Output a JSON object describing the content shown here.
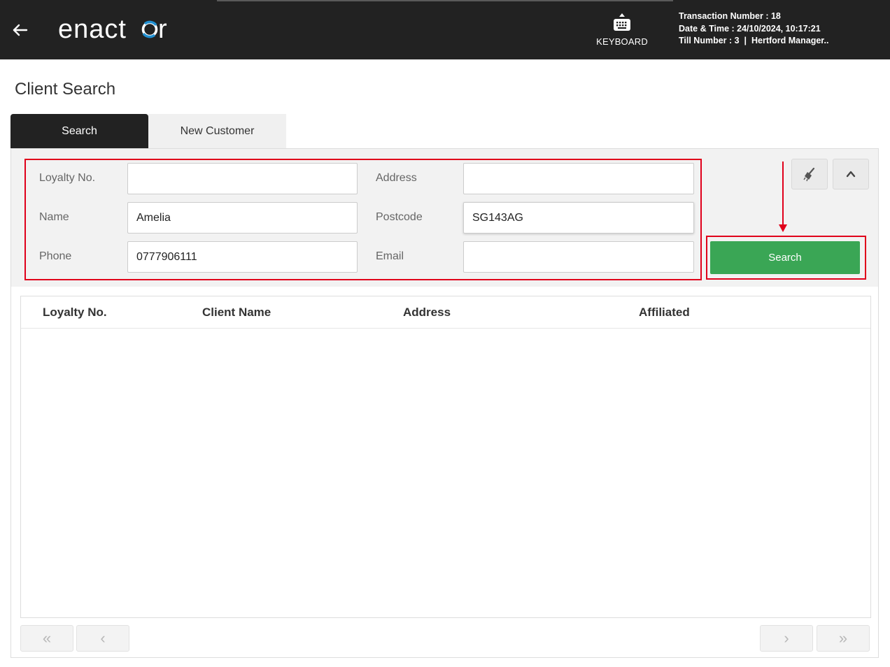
{
  "header": {
    "brand": "enactor",
    "keyboard_label": "KEYBOARD",
    "transaction": "Transaction Number : 18",
    "datetime": "Date & Time : 24/10/2024, 10:17:21",
    "till": "Till Number : 3  |  Hertford Manager.."
  },
  "page": {
    "title": "Client Search"
  },
  "tabs": [
    {
      "label": "Search",
      "active": true
    },
    {
      "label": "New Customer",
      "active": false
    }
  ],
  "form": {
    "loyalty_label": "Loyalty No.",
    "loyalty_value": "",
    "name_label": "Name",
    "name_value": "Amelia",
    "phone_label": "Phone",
    "phone_value": "0777906111",
    "address_label": "Address",
    "address_value": "",
    "postcode_label": "Postcode",
    "postcode_value": "SG143AG",
    "email_label": "Email",
    "email_value": ""
  },
  "search_button": "Search",
  "results": {
    "columns": [
      "Loyalty No.",
      "Client Name",
      "Address",
      "Affiliated"
    ],
    "rows": []
  },
  "pager": {
    "first": "«",
    "prev": "‹",
    "next": "›",
    "last": "»"
  },
  "colors": {
    "topbar": "#222222",
    "accent_green": "#3aa655",
    "highlight_red": "#e0001b",
    "logo_blue": "#1f8fd1"
  }
}
